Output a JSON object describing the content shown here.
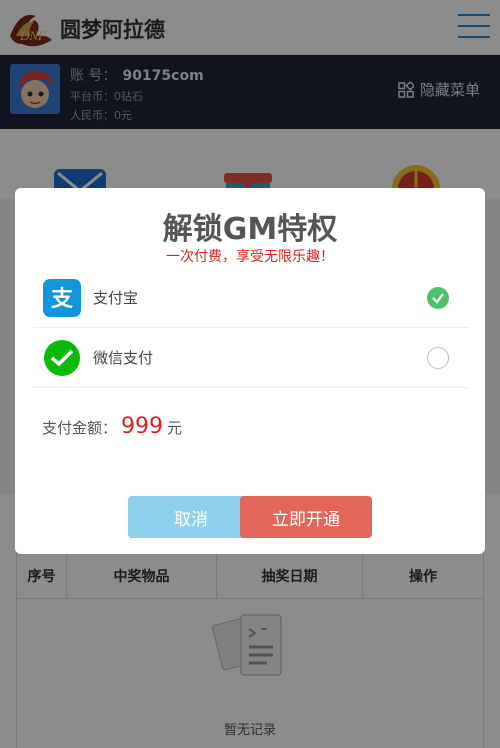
{
  "header": {
    "title": "圆梦阿拉德",
    "menu_icon": "hamburger-menu-icon"
  },
  "account": {
    "account_label": "账 号：",
    "account_value": "90175com",
    "platform_coin": "平台币：0钻石",
    "rmb": "人民币：0元",
    "hide_menu_label": "隐藏菜单"
  },
  "background": {
    "table_headers": [
      "序号",
      "中奖物品",
      "抽奖日期",
      "操作"
    ],
    "empty_text": "暂无记录"
  },
  "modal": {
    "title": "解锁GM特权",
    "subtitle": "一次付费，享受无限乐趣！",
    "payment_methods": [
      {
        "label": "支付宝",
        "icon": "alipay-icon",
        "selected": true
      },
      {
        "label": "微信支付",
        "icon": "wechat-pay-icon",
        "selected": false
      }
    ],
    "amount_label": "支付金额：",
    "amount_value": "999",
    "amount_unit": "元",
    "cancel_label": "取消",
    "confirm_label": "立即开通"
  },
  "colors": {
    "accent_blue": "#2f86c8",
    "account_bar": "#1f2337",
    "red": "#e02020",
    "cancel_btn": "#8fd0ef",
    "confirm_btn": "#e0675a",
    "check_green": "#4ec36a"
  }
}
